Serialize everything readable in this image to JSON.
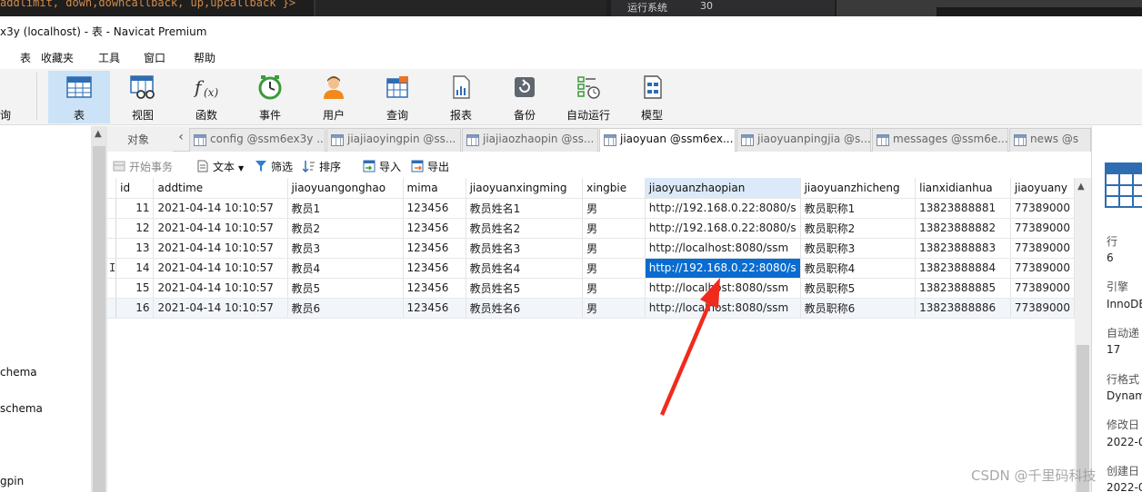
{
  "top_strip": {
    "code_fragment": "addlimit, down,downcallback, up,upcallback }>",
    "system_label": "运行系统",
    "system_value": "30"
  },
  "window": {
    "title": "x3y (localhost) - 表 - Navicat Premium"
  },
  "menu": {
    "items": [
      "表",
      "收藏夹",
      "工具",
      "窗口",
      "帮助"
    ]
  },
  "toolbar": {
    "partial_left": "询",
    "items": [
      {
        "label": "表",
        "icon": "table-icon",
        "active": true
      },
      {
        "label": "视图",
        "icon": "view-icon"
      },
      {
        "label": "函数",
        "icon": "function-icon"
      },
      {
        "label": "事件",
        "icon": "event-clock-icon"
      },
      {
        "label": "用户",
        "icon": "user-icon"
      },
      {
        "label": "查询",
        "icon": "query-icon"
      },
      {
        "label": "报表",
        "icon": "report-icon"
      },
      {
        "label": "备份",
        "icon": "backup-icon"
      },
      {
        "label": "自动运行",
        "icon": "auto-run-icon"
      },
      {
        "label": "模型",
        "icon": "model-icon"
      }
    ]
  },
  "sidebar": {
    "items": [
      "chema",
      "schema",
      "gpin"
    ]
  },
  "tabs": {
    "object_label": "对象",
    "items": [
      {
        "label": "config @ssm6ex3y ...",
        "active": false
      },
      {
        "label": "jiajiaoyingpin @ss...",
        "active": false
      },
      {
        "label": "jiajiaozhaopin @ss...",
        "active": false
      },
      {
        "label": "jiaoyuan @ssm6ex...",
        "active": true
      },
      {
        "label": "jiaoyuanpingjia @s...",
        "active": false
      },
      {
        "label": "messages @ssm6e...",
        "active": false
      },
      {
        "label": "news @s",
        "active": false
      }
    ]
  },
  "subtoolbar": {
    "begin_transaction": "开始事务",
    "text": "文本",
    "filter": "筛选",
    "sort": "排序",
    "import": "导入",
    "export": "导出"
  },
  "grid": {
    "columns": [
      "id",
      "addtime",
      "jiaoyuangonghao",
      "mima",
      "jiaoyuanxingming",
      "xingbie",
      "jiaoyuanzhaopian",
      "jiaoyuanzhicheng",
      "lianxidianhua",
      "jiaoyuany"
    ],
    "selected_column": 6,
    "current_row_marker": "I",
    "selected_row": 3,
    "rows": [
      [
        "11",
        "2021-04-14 10:10:57",
        "教员1",
        "123456",
        "教员姓名1",
        "男",
        "http://192.168.0.22:8080/s",
        "教员职称1",
        "13823888881",
        "77389000"
      ],
      [
        "12",
        "2021-04-14 10:10:57",
        "教员2",
        "123456",
        "教员姓名2",
        "男",
        "http://192.168.0.22:8080/s",
        "教员职称2",
        "13823888882",
        "77389000"
      ],
      [
        "13",
        "2021-04-14 10:10:57",
        "教员3",
        "123456",
        "教员姓名3",
        "男",
        "http://localhost:8080/ssm",
        "教员职称3",
        "13823888883",
        "77389000"
      ],
      [
        "14",
        "2021-04-14 10:10:57",
        "教员4",
        "123456",
        "教员姓名4",
        "男",
        "http://192.168.0.22:8080/s",
        "教员职称4",
        "13823888884",
        "77389000"
      ],
      [
        "15",
        "2021-04-14 10:10:57",
        "教员5",
        "123456",
        "教员姓名5",
        "男",
        "http://localhost:8080/ssm",
        "教员职称5",
        "13823888885",
        "77389000"
      ],
      [
        "16",
        "2021-04-14 10:10:57",
        "教员6",
        "123456",
        "教员姓名6",
        "男",
        "http://localhost:8080/ssm",
        "教员职称6",
        "13823888886",
        "77389000"
      ]
    ]
  },
  "info_panel": {
    "rows_label": "行",
    "rows_value": "6",
    "engine_label": "引擎",
    "engine_value": "InnoDB",
    "auto_inc_label": "自动递",
    "auto_inc_value": "17",
    "row_format_label": "行格式",
    "row_format_value": "Dynam",
    "modified_label": "修改日",
    "modified_value": "2022-0",
    "created_label": "创建日",
    "created_value": "2022-0"
  },
  "watermark": "CSDN @千里码科技",
  "colors": {
    "accent": "#0a6cd0",
    "annotation_arrow": "#f02b1d",
    "active_tool": "#cce3f7"
  }
}
